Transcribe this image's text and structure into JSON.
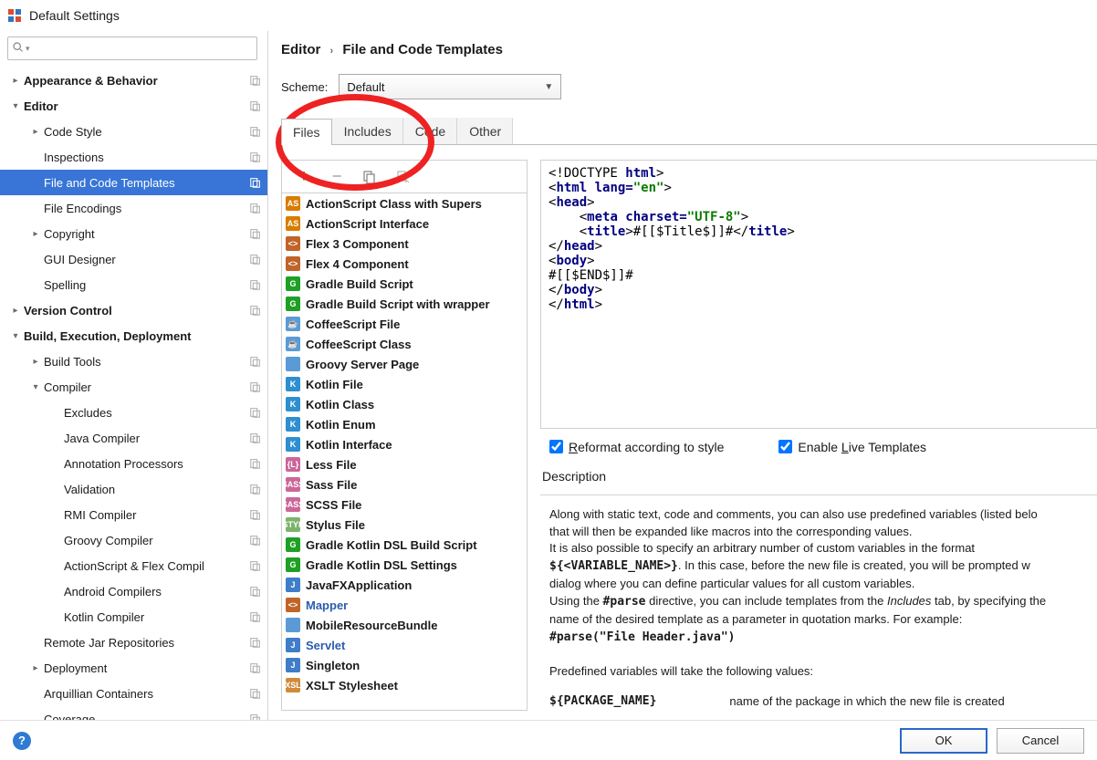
{
  "window": {
    "title": "Default Settings"
  },
  "search": {
    "placeholder": ""
  },
  "sidebar": {
    "items": [
      {
        "label": "Appearance & Behavior",
        "depth": 0,
        "bold": true,
        "chev": "col",
        "icon": true
      },
      {
        "label": "Editor",
        "depth": 0,
        "bold": true,
        "chev": "exp",
        "icon": true
      },
      {
        "label": "Code Style",
        "depth": 1,
        "bold": false,
        "chev": "col",
        "icon": true
      },
      {
        "label": "Inspections",
        "depth": 1,
        "bold": false,
        "chev": "none",
        "icon": true
      },
      {
        "label": "File and Code Templates",
        "depth": 1,
        "bold": false,
        "chev": "none",
        "icon": true,
        "selected": true
      },
      {
        "label": "File Encodings",
        "depth": 1,
        "bold": false,
        "chev": "none",
        "icon": true
      },
      {
        "label": "Copyright",
        "depth": 1,
        "bold": false,
        "chev": "col",
        "icon": true
      },
      {
        "label": "GUI Designer",
        "depth": 1,
        "bold": false,
        "chev": "none",
        "icon": true
      },
      {
        "label": "Spelling",
        "depth": 1,
        "bold": false,
        "chev": "none",
        "icon": true
      },
      {
        "label": "Version Control",
        "depth": 0,
        "bold": true,
        "chev": "col",
        "icon": true
      },
      {
        "label": "Build, Execution, Deployment",
        "depth": 0,
        "bold": true,
        "chev": "exp",
        "icon": false
      },
      {
        "label": "Build Tools",
        "depth": 1,
        "bold": false,
        "chev": "col",
        "icon": true
      },
      {
        "label": "Compiler",
        "depth": 1,
        "bold": false,
        "chev": "exp",
        "icon": true
      },
      {
        "label": "Excludes",
        "depth": 2,
        "bold": false,
        "chev": "none",
        "icon": true
      },
      {
        "label": "Java Compiler",
        "depth": 2,
        "bold": false,
        "chev": "none",
        "icon": true
      },
      {
        "label": "Annotation Processors",
        "depth": 2,
        "bold": false,
        "chev": "none",
        "icon": true
      },
      {
        "label": "Validation",
        "depth": 2,
        "bold": false,
        "chev": "none",
        "icon": true
      },
      {
        "label": "RMI Compiler",
        "depth": 2,
        "bold": false,
        "chev": "none",
        "icon": true
      },
      {
        "label": "Groovy Compiler",
        "depth": 2,
        "bold": false,
        "chev": "none",
        "icon": true
      },
      {
        "label": "ActionScript & Flex Compil",
        "depth": 2,
        "bold": false,
        "chev": "none",
        "icon": true
      },
      {
        "label": "Android Compilers",
        "depth": 2,
        "bold": false,
        "chev": "none",
        "icon": true
      },
      {
        "label": "Kotlin Compiler",
        "depth": 2,
        "bold": false,
        "chev": "none",
        "icon": true
      },
      {
        "label": "Remote Jar Repositories",
        "depth": 1,
        "bold": false,
        "chev": "none",
        "icon": true
      },
      {
        "label": "Deployment",
        "depth": 1,
        "bold": false,
        "chev": "col",
        "icon": true
      },
      {
        "label": "Arquillian Containers",
        "depth": 1,
        "bold": false,
        "chev": "none",
        "icon": true
      },
      {
        "label": "Coverage",
        "depth": 1,
        "bold": false,
        "chev": "none",
        "icon": true
      }
    ]
  },
  "breadcrumb": {
    "a": "Editor",
    "b": "File and Code Templates"
  },
  "scheme": {
    "label": "Scheme:",
    "value": "Default"
  },
  "tabs": [
    {
      "label": "Files",
      "active": true
    },
    {
      "label": "Includes",
      "active": false
    },
    {
      "label": "Code",
      "active": false
    },
    {
      "label": "Other",
      "active": false
    }
  ],
  "templates": [
    {
      "label": "ActionScript Class with Supers",
      "ic": "as",
      "t": "AS"
    },
    {
      "label": "ActionScript Interface",
      "ic": "as",
      "t": "AS"
    },
    {
      "label": "Flex 3 Component",
      "ic": "xml",
      "t": "<>"
    },
    {
      "label": "Flex 4 Component",
      "ic": "xml",
      "t": "<>"
    },
    {
      "label": "Gradle Build Script",
      "ic": "g",
      "t": "G"
    },
    {
      "label": "Gradle Build Script with wrapper",
      "ic": "g",
      "t": "G"
    },
    {
      "label": "CoffeeScript File",
      "ic": "f",
      "t": "☕"
    },
    {
      "label": "CoffeeScript Class",
      "ic": "f",
      "t": "☕"
    },
    {
      "label": "Groovy Server Page",
      "ic": "f",
      "t": ""
    },
    {
      "label": "Kotlin File",
      "ic": "k",
      "t": "K"
    },
    {
      "label": "Kotlin Class",
      "ic": "k",
      "t": "K"
    },
    {
      "label": "Kotlin Enum",
      "ic": "k",
      "t": "K"
    },
    {
      "label": "Kotlin Interface",
      "ic": "k",
      "t": "K"
    },
    {
      "label": "Less File",
      "ic": "s",
      "t": "{L}"
    },
    {
      "label": "Sass File",
      "ic": "s",
      "t": "SASS"
    },
    {
      "label": "SCSS File",
      "ic": "s",
      "t": "SASS"
    },
    {
      "label": "Stylus File",
      "ic": "sty",
      "t": "STYL"
    },
    {
      "label": "Gradle Kotlin DSL Build Script",
      "ic": "g",
      "t": "G"
    },
    {
      "label": "Gradle Kotlin DSL Settings",
      "ic": "g",
      "t": "G"
    },
    {
      "label": "JavaFXApplication",
      "ic": "j",
      "t": "J"
    },
    {
      "label": "Mapper",
      "ic": "xml",
      "t": "<>",
      "link": true
    },
    {
      "label": "MobileResourceBundle",
      "ic": "f",
      "t": ""
    },
    {
      "label": "Servlet",
      "ic": "j",
      "t": "J",
      "link": true
    },
    {
      "label": "Singleton",
      "ic": "j",
      "t": "J"
    },
    {
      "label": "XSLT Stylesheet",
      "ic": "xsl",
      "t": "XSL"
    }
  ],
  "code": {
    "l1a": "<!DOCTYPE ",
    "l1b": "html",
    "l1c": ">",
    "l2a": "<",
    "l2b": "html lang=",
    "l2c": "\"en\"",
    "l2d": ">",
    "l3a": "<",
    "l3b": "head",
    "l3c": ">",
    "l4a": "    <",
    "l4b": "meta charset=",
    "l4c": "\"UTF-8\"",
    "l4d": ">",
    "l5a": "    <",
    "l5b": "title",
    "l5c": ">",
    "l5d": "#[[$Title$]]#",
    "l5e": "</",
    "l5f": "title",
    "l5g": ">",
    "l6a": "</",
    "l6b": "head",
    "l6c": ">",
    "l7a": "<",
    "l7b": "body",
    "l7c": ">",
    "l8": "#[[$END$]]#",
    "l9a": "</",
    "l9b": "body",
    "l9c": ">",
    "l10a": "</",
    "l10b": "html",
    "l10c": ">"
  },
  "checkboxes": {
    "reformat": "Reformat according to style",
    "livetmpl": "Enable Live Templates"
  },
  "description": {
    "label": "Description",
    "p1": "Along with static text, code and comments, you can also use predefined variables (listed belo",
    "p2": "that will then be expanded like macros into the corresponding values.",
    "p3": "It is also possible to specify an arbitrary number of custom variables in the format ",
    "p3b": "${<VARIABLE_NAME>}",
    "p3c": ". In this case, before the new file is created, you will be prompted w",
    "p4": "dialog where you can define particular values for all custom variables.",
    "p5a": "Using the ",
    "p5b": "#parse",
    "p5c": " directive, you can include templates from the ",
    "p5d": "Includes",
    "p5e": " tab, by specifying the",
    "p6": "name of the desired template as a parameter in quotation marks. For example:",
    "p7": "#parse(\"File Header.java\")",
    "p8": "Predefined variables will take the following values:",
    "var": "${PACKAGE_NAME}",
    "vard": "name of the package in which the new file is created"
  },
  "footer": {
    "ok": "OK",
    "cancel": "Cancel"
  }
}
